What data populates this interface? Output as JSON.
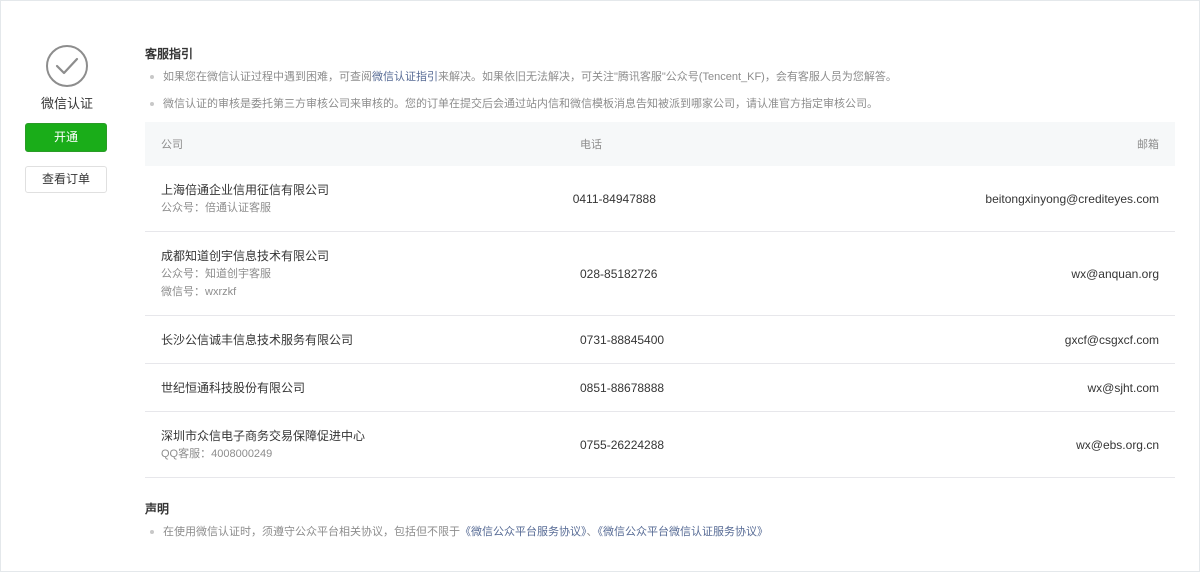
{
  "sidebar": {
    "title": "微信认证",
    "enable_button": "开通",
    "orders_button": "查看订单",
    "icon": "check-circle-icon",
    "accent_color": "#1aad19"
  },
  "guide": {
    "title": "客服指引",
    "tip1_before": "如果您在微信认证过程中遇到困难，可查阅",
    "tip1_link": "微信认证指引",
    "tip1_after": "来解决。如果依旧无法解决，可关注\"腾讯客服\"公众号(Tencent_KF)，会有客服人员为您解答。",
    "tip2": "微信认证的审核是委托第三方审核公司来审核的。您的订单在提交后会通过站内信和微信模板消息告知被派到哪家公司，请认准官方指定审核公司。"
  },
  "table": {
    "headers": {
      "company": "公司",
      "phone": "电话",
      "email": "邮箱"
    },
    "rows": [
      {
        "name": "上海倍通企业信用征信有限公司",
        "subs": [
          "公众号：倍通认证客服"
        ],
        "phone": "0411-84947888",
        "email": "beitongxinyong@crediteyes.com"
      },
      {
        "name": "成都知道创宇信息技术有限公司",
        "subs": [
          "公众号：知道创宇客服",
          "微信号：wxrzkf"
        ],
        "phone": "028-85182726",
        "email": "wx@anquan.org"
      },
      {
        "name": "长沙公信诚丰信息技术服务有限公司",
        "subs": [],
        "phone": "0731-88845400",
        "email": "gxcf@csgxcf.com"
      },
      {
        "name": "世纪恒通科技股份有限公司",
        "subs": [],
        "phone": "0851-88678888",
        "email": "wx@sjht.com"
      },
      {
        "name": "深圳市众信电子商务交易保障促进中心",
        "subs": [
          "QQ客服：4008000249"
        ],
        "phone": "0755-26224288",
        "email": "wx@ebs.org.cn"
      }
    ]
  },
  "statement": {
    "title": "声明",
    "text_before": "在使用微信认证时，须遵守公众平台相关协议，包括但不限于",
    "link1": "《微信公众平台服务协议》",
    "separator": "、",
    "link2": "《微信公众平台微信认证服务协议》"
  }
}
